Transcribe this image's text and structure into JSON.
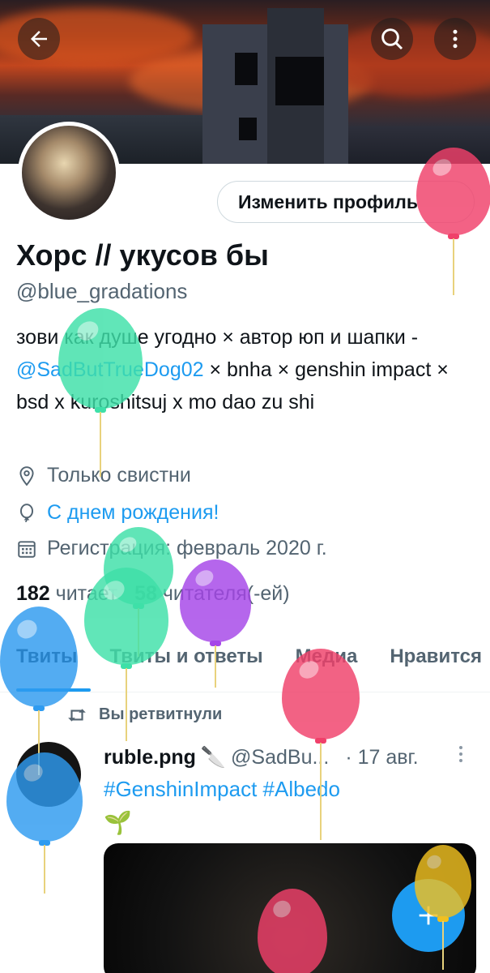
{
  "header": {
    "back_icon": "arrow-left-icon",
    "search_icon": "search-icon",
    "more_icon": "more-vertical-icon"
  },
  "profile": {
    "edit_button": "Изменить профиль",
    "name": "Хорс // укусов бы",
    "handle": "@blue_gradations",
    "bio_before": "зови как душе угодно × автор юп и шапки - ",
    "bio_mention": "@SadButTrueDog02",
    "bio_after": " × bnha × genshin impact × bsd x kuroshitsuj x  mo dao zu shi",
    "location": "Только свистни",
    "birthday": "С днем рождения!",
    "joined": "Регистрация: февраль 2020 г.",
    "following_count": "182",
    "following_label": " читает",
    "followers_count": "58",
    "followers_label": " читателя(-ей)"
  },
  "tabs": [
    "Твиты",
    "Твиты и ответы",
    "Медиа",
    "Нравится"
  ],
  "tweet": {
    "retweet_label": "Вы ретвитнули",
    "author_name": "ruble.png",
    "author_emoji": "🔪",
    "author_handle": "@SadBu...",
    "time": "· 17 авг.",
    "hashtags": "#GenshinImpact #Albedo",
    "emoji": "🌱"
  },
  "colors": {
    "accent": "#1d9bf0",
    "balloon_pink": "#f0406a",
    "balloon_green": "#3ee0a8",
    "balloon_blue": "#2e9bf0",
    "balloon_purple": "#a545e8",
    "balloon_yellow": "#f0c020"
  }
}
